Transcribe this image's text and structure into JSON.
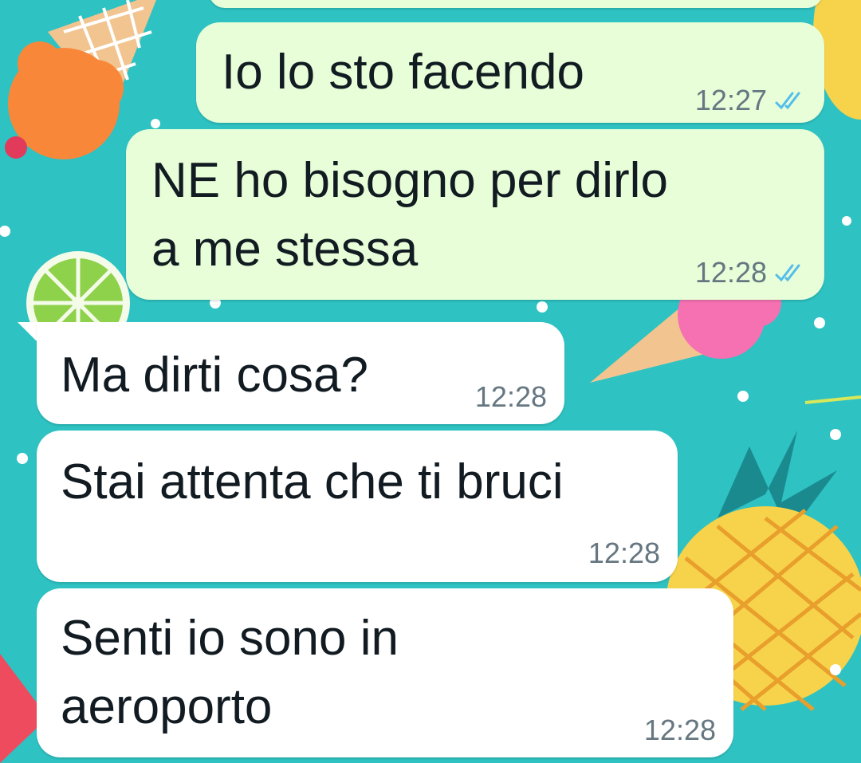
{
  "chat": {
    "messages": [
      {
        "direction": "outgoing",
        "text": "Io lo sto facendo",
        "time": "12:27",
        "status": "read"
      },
      {
        "direction": "outgoing",
        "line1": "NE ho bisogno per dirlo",
        "line2": "a me stessa",
        "time": "12:28",
        "status": "read"
      },
      {
        "direction": "incoming",
        "text": "Ma dirti cosa?",
        "time": "12:28"
      },
      {
        "direction": "incoming",
        "text": "Stai attenta che ti bruci",
        "time": "12:28"
      },
      {
        "direction": "incoming",
        "line1": "Senti io sono in",
        "line2": "aeroporto",
        "time": "12:28"
      }
    ]
  },
  "theme": {
    "wallpaper_color": "#2ec2c2",
    "outgoing_bubble": "#e7fed8",
    "incoming_bubble": "#ffffff",
    "read_tick_color": "#53bdeb",
    "time_color": "#667781"
  },
  "icons": {
    "read_receipt": "double-check-icon"
  }
}
